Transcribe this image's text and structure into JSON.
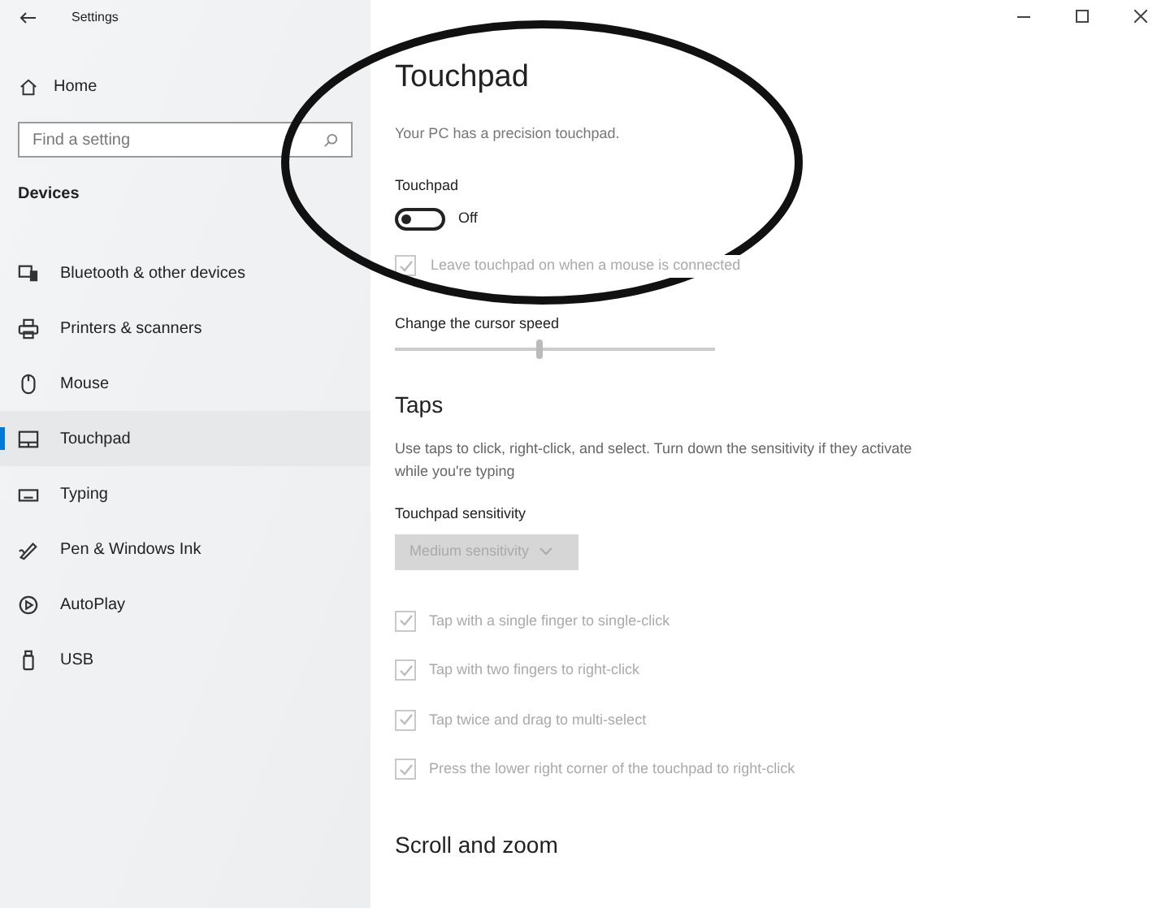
{
  "window": {
    "title": "Settings"
  },
  "sidebar": {
    "home": "Home",
    "search": {
      "placeholder": "Find a setting"
    },
    "section": "Devices",
    "items": [
      {
        "label": "Bluetooth & other devices",
        "kind": "bluetooth",
        "selected": false
      },
      {
        "label": "Printers & scanners",
        "kind": "printer",
        "selected": false
      },
      {
        "label": "Mouse",
        "kind": "mouse",
        "selected": false
      },
      {
        "label": "Touchpad",
        "kind": "touchpad",
        "selected": true
      },
      {
        "label": "Typing",
        "kind": "keyboard",
        "selected": false
      },
      {
        "label": "Pen & Windows Ink",
        "kind": "pen",
        "selected": false
      },
      {
        "label": "AutoPlay",
        "kind": "autoplay",
        "selected": false
      },
      {
        "label": "USB",
        "kind": "usb",
        "selected": false
      }
    ]
  },
  "page": {
    "title": "Touchpad",
    "subtitle": "Your PC has a precision touchpad.",
    "toggle": {
      "label": "Touchpad",
      "on": false,
      "state_text": "Off"
    },
    "leave_on": {
      "label": "Leave touchpad on when a mouse is connected",
      "checked": true,
      "disabled": true
    },
    "cursor_speed": {
      "label": "Change the cursor speed",
      "level": 0.45
    },
    "taps": {
      "title": "Taps",
      "description": "Use taps to click, right-click, and select. Turn down the sensitivity if they activate while you're typing",
      "sensitivity_label": "Touchpad sensitivity",
      "sensitivity": {
        "value": "Medium sensitivity",
        "disabled": true
      },
      "options": [
        {
          "label": "Tap with a single finger to single-click",
          "checked": true,
          "disabled": true
        },
        {
          "label": "Tap with two fingers to right-click",
          "checked": true,
          "disabled": true
        },
        {
          "label": "Tap twice and drag to multi-select",
          "checked": true,
          "disabled": true
        },
        {
          "label": "Press the lower right corner of the touchpad to right-click",
          "checked": true,
          "disabled": true
        }
      ]
    },
    "scroll_title": "Scroll and zoom"
  }
}
